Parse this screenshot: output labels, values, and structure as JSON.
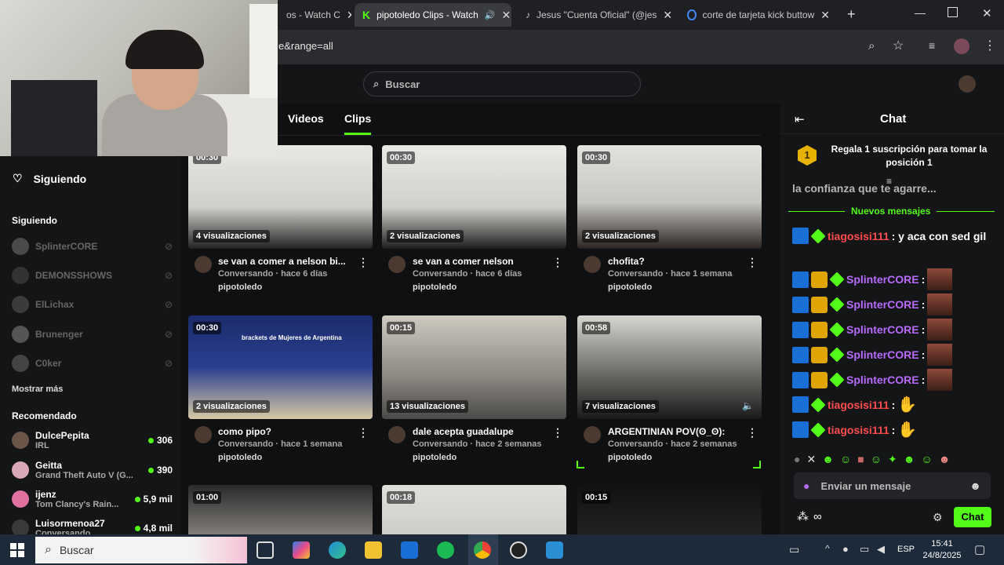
{
  "browser": {
    "tabs": [
      {
        "label": "os - Watch C",
        "active": false
      },
      {
        "label": "pipotoledo Clips - Watch",
        "active": true
      },
      {
        "label": "Jesus \"Cuenta Oficial\" (@jes",
        "active": false
      },
      {
        "label": "corte de tarjeta kick buttow",
        "active": false
      }
    ],
    "url": "e&range=all"
  },
  "header": {
    "search_placeholder": "Buscar",
    "tabs": [
      "Videos",
      "Clips"
    ],
    "active_tab": "Clips"
  },
  "sidebar": {
    "following_title": "Siguiendo",
    "section_following": "Siguiendo",
    "following": [
      "SplinterCORE",
      "DEMONSSHOWS",
      "ElLichax",
      "Brunenger",
      "C0ker"
    ],
    "show_more": "Mostrar más",
    "recommended_title": "Recomendado",
    "recommended": [
      {
        "name": "DulcePepita",
        "category": "IRL",
        "viewers": "306"
      },
      {
        "name": "Geitta",
        "category": "Grand Theft Auto V (G...",
        "viewers": "390"
      },
      {
        "name": "ijenz",
        "category": "Tom Clancy's Rain...",
        "viewers": "5,9 mil"
      },
      {
        "name": "Luisormenoa27",
        "category": "Conversando",
        "viewers": "4,8 mil"
      }
    ]
  },
  "clips": [
    {
      "duration": "00:30",
      "views": "4 visualizaciones",
      "title": "se van a comer a nelson bi...",
      "meta": "Conversando · hace 6 días",
      "author": "pipotoledo"
    },
    {
      "duration": "00:30",
      "views": "2 visualizaciones",
      "title": "se van a comer nelson",
      "meta": "Conversando · hace 6 días",
      "author": "pipotoledo"
    },
    {
      "duration": "00:30",
      "views": "2 visualizaciones",
      "title": "chofita?",
      "meta": "Conversando · hace 1 semana",
      "author": "pipotoledo"
    },
    {
      "duration": "00:30",
      "views": "2 visualizaciones",
      "title": "como pipo?",
      "meta": "Conversando · hace 1 semana",
      "author": "pipotoledo",
      "thumb_text": "brackets de Mujeres de Argentina"
    },
    {
      "duration": "00:15",
      "views": "13 visualizaciones",
      "title": "dale acepta guadalupe",
      "meta": "Conversando · hace 2 semanas",
      "author": "pipotoledo"
    },
    {
      "duration": "00:58",
      "views": "7 visualizaciones",
      "title": "ARGENTINIAN POV(ʘ_ʘ):",
      "meta": "Conversando · hace 2 semanas",
      "author": "pipotoledo"
    },
    {
      "duration": "01:00"
    },
    {
      "duration": "00:18"
    },
    {
      "duration": "00:15"
    }
  ],
  "chat": {
    "title": "Chat",
    "pinned_rank": "1",
    "pinned_text": "Regala 1 suscripción para tomar la posición 1",
    "partial_line": "la confianza que te agarre...",
    "new_messages": "Nuevos mensajes",
    "messages": [
      {
        "user": "tiagosisi111",
        "text": ": y aca con sed gil",
        "color": "#ff4d4d"
      },
      {
        "user": "SplinterCORE",
        "text": ":",
        "color": "#b86bff"
      },
      {
        "user": "SplinterCORE",
        "text": ":",
        "color": "#b86bff"
      },
      {
        "user": "SplinterCORE",
        "text": ":",
        "color": "#b86bff"
      },
      {
        "user": "SplinterCORE",
        "text": ":",
        "color": "#b86bff"
      },
      {
        "user": "SplinterCORE",
        "text": ":",
        "color": "#b86bff"
      },
      {
        "user": "tiagosisi111",
        "text": ":",
        "color": "#ff4d4d"
      },
      {
        "user": "tiagosisi111",
        "text": ":",
        "color": "#ff4d4d"
      }
    ],
    "input_placeholder": "Enviar un mensaje",
    "send_label": "Chat",
    "points": "∞"
  },
  "taskbar": {
    "search_placeholder": "Buscar",
    "lang": "ESP",
    "time": "15:41",
    "date": "24/8/2025"
  },
  "colors": {
    "accent": "#53fc18",
    "bg": "#0f1012",
    "panel": "#141517"
  }
}
